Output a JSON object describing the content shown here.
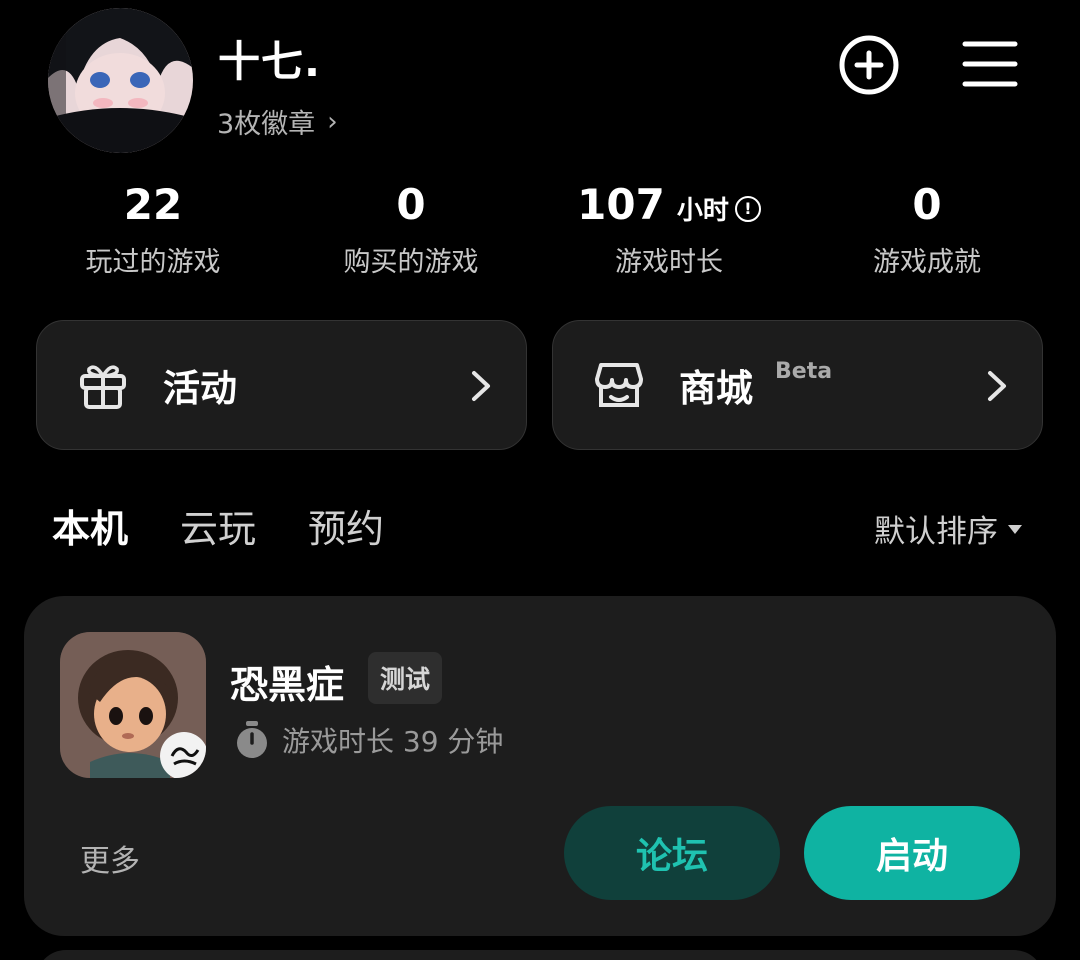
{
  "profile": {
    "username": "十七.",
    "badges": "3枚徽章",
    "badges_chevron": "›"
  },
  "header_icons": [
    "add-circle-icon",
    "menu-icon"
  ],
  "stats": [
    {
      "value": "22",
      "unit": "",
      "label": "玩过的游戏"
    },
    {
      "value": "0",
      "unit": "",
      "label": "购买的游戏"
    },
    {
      "value": "107",
      "unit": "小时",
      "info": "!",
      "label": "游戏时长"
    },
    {
      "value": "0",
      "unit": "",
      "label": "游戏成就"
    }
  ],
  "cards": {
    "activity": {
      "label": "活动",
      "icon": "gift-icon"
    },
    "mall": {
      "label": "商城",
      "badge": "Beta",
      "icon": "store-icon"
    }
  },
  "tabs": [
    {
      "label": "本机",
      "active": true
    },
    {
      "label": "云玩",
      "active": false
    },
    {
      "label": "预约",
      "active": false
    }
  ],
  "sort": {
    "label": "默认排序"
  },
  "game": {
    "title": "恐黑症",
    "tag": "测试",
    "playtime": "游戏时长 39 分钟",
    "more": "更多",
    "forum_button": "论坛",
    "launch_button": "启动"
  },
  "colors": {
    "accent": "#0fb3a2",
    "background": "#000000",
    "card": "#1c1c1c"
  }
}
